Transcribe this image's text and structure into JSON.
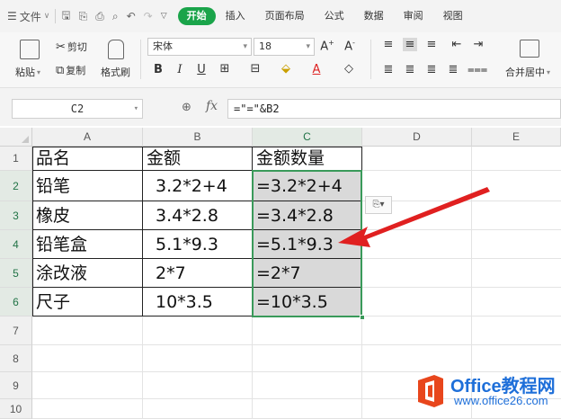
{
  "menubar": {
    "file_menu": "文件",
    "tabs": [
      {
        "label": "开始",
        "active": true
      },
      {
        "label": "插入"
      },
      {
        "label": "页面布局"
      },
      {
        "label": "公式"
      },
      {
        "label": "数据"
      },
      {
        "label": "审阅"
      },
      {
        "label": "视图"
      }
    ]
  },
  "ribbon": {
    "paste_label": "粘贴",
    "cut_label": "剪切",
    "copy_label": "复制",
    "format_painter_label": "格式刷",
    "font_name": "宋体",
    "font_size": "18",
    "merge_label": "合并居中",
    "accent_color": "#1aa44a"
  },
  "formula_bar": {
    "name_box": "C2",
    "fx_label": "fx",
    "formula": "=\"=\"&B2"
  },
  "sheet": {
    "columns": [
      "A",
      "B",
      "C",
      "D",
      "E"
    ],
    "rows": [
      "1",
      "2",
      "3",
      "4",
      "5",
      "6",
      "7",
      "8",
      "9",
      "10"
    ],
    "selected_column": "C",
    "table": {
      "header": [
        "品名",
        "金额",
        "金额数量"
      ],
      "rows": [
        [
          "铅笔",
          "3.2*2+4",
          "=3.2*2+4"
        ],
        [
          "橡皮",
          "3.4*2.8",
          "=3.4*2.8"
        ],
        [
          "铅笔盒",
          "5.1*9.3",
          "=5.1*9.3"
        ],
        [
          "涂改液",
          "2*7",
          "=2*7"
        ],
        [
          "尺子",
          "10*3.5",
          "=10*3.5"
        ]
      ]
    },
    "selection_color": "#3a9a5a",
    "arrow_color": "#e02020"
  },
  "watermark": {
    "brand": "Office教程网",
    "url": "www.office26.com"
  }
}
